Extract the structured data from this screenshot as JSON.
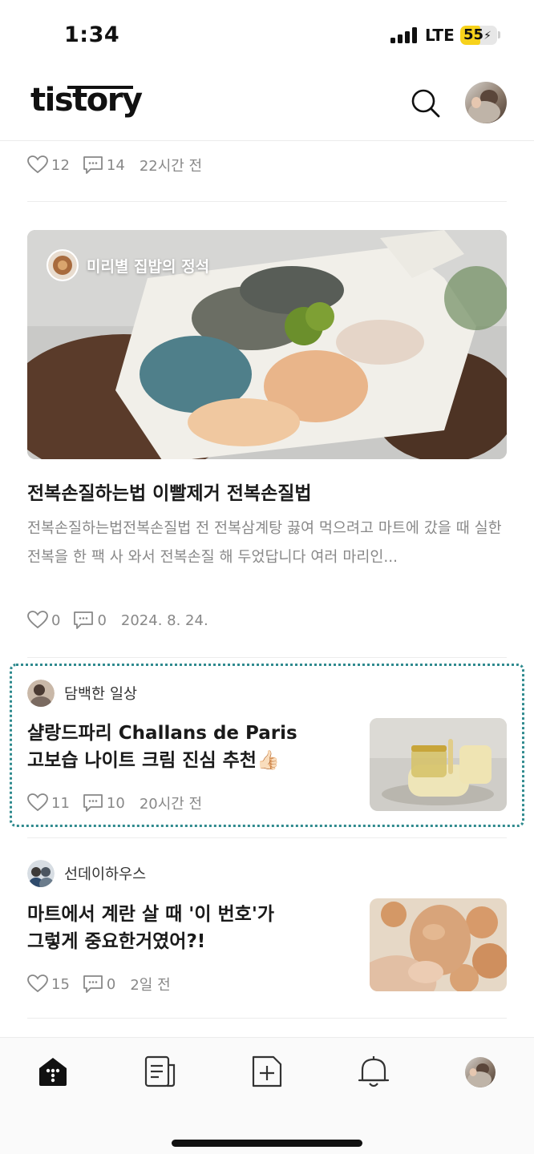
{
  "status_bar": {
    "time": "1:34",
    "network": "LTE",
    "battery": "55",
    "battery_level": 0.55
  },
  "header": {
    "logo": "tistory"
  },
  "prev_post": {
    "likes": "12",
    "comments": "14",
    "date": "22시간 전"
  },
  "featured_post": {
    "blog_name": "미리별 집밥의 정석",
    "title": "전복손질하는법 이빨제거 전복손질법",
    "excerpt": "전복손질하는법전복손질법  전 전복삼계탕 끓여 먹으려고 마트에 갔을 때  실한 전복을 한 팩 사 와서 전복손질 해 두었답니다 여러 마리인...",
    "likes": "0",
    "comments": "0",
    "date": "2024. 8. 24."
  },
  "posts": [
    {
      "blog_name": "담백한 일상",
      "title_line1": "샬랑드파리 Challans de Paris",
      "title_line2": "고보습 나이트 크림 진심 추천👍🏻",
      "likes": "11",
      "comments": "10",
      "date": "20시간 전"
    },
    {
      "blog_name": "선데이하우스",
      "title_line1": "마트에서 계란 살 때 '이 번호'가",
      "title_line2": "그렇게 중요한거였어?!",
      "likes": "15",
      "comments": "0",
      "date": "2일 전"
    }
  ],
  "bottom_nav": [
    "home-icon",
    "feed-icon",
    "write-icon",
    "bell-icon",
    "profile-avatar"
  ],
  "colors": {
    "highlight": "#2f8a8e",
    "battery": "#f7d21b",
    "muted": "#888888"
  }
}
